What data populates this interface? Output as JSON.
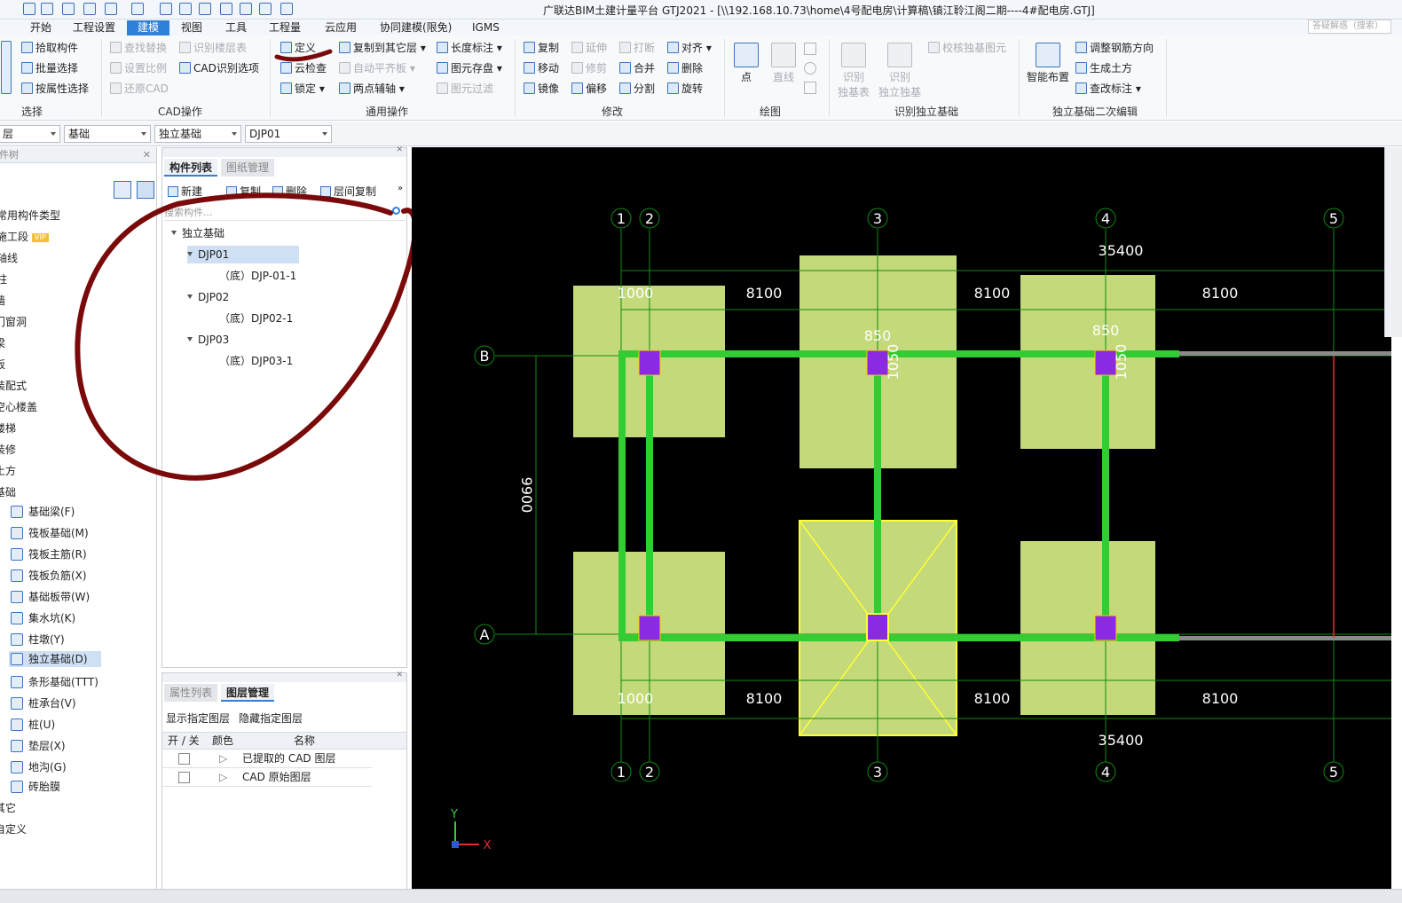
{
  "titlebar": {
    "title": "广联达BIM土建计量平台 GTJ2021 - [\\\\192.168.10.73\\home\\4号配电房\\计算稿\\镇江聆江阁二期----4#配电房.GTJ]",
    "search_placeholder": "答疑解惑（搜索）"
  },
  "menubar": [
    "开始",
    "工程设置",
    "建模",
    "视图",
    "工具",
    "工程量",
    "云应用",
    "协同建模(限免)",
    "IGMS"
  ],
  "ribbon": {
    "select": {
      "pick": "拾取构件",
      "batch": "批量选择",
      "by_attr": "按属性选择",
      "group": "选择"
    },
    "cad": {
      "find_replace": "查找替换",
      "identify_table": "识别楼层表",
      "set_scale": "设置比例",
      "cad_options": "CAD识别选项",
      "restore_cad": "还原CAD",
      "group": "CAD操作"
    },
    "common": {
      "define": "定义",
      "cloud_check": "云检查",
      "lock": "锁定",
      "copy_to_floor": "复制到其它层",
      "auto_align": "自动平齐板",
      "two_point_axis": "两点辅轴",
      "length_mark": "长度标注",
      "element_save": "图元存盘",
      "element_filter": "图元过滤",
      "group": "通用操作"
    },
    "modify": {
      "copy": "复制",
      "extend": "延伸",
      "break": "打断",
      "align": "对齐",
      "move": "移动",
      "trim": "修剪",
      "merge": "合并",
      "delete": "删除",
      "mirror": "镜像",
      "offset": "偏移",
      "split": "分割",
      "rotate": "旋转",
      "group": "修改"
    },
    "draw": {
      "point": "点",
      "line": "直线",
      "group": "绘图"
    },
    "identify": {
      "check": "校核独基图元",
      "table_l1": "识别",
      "table_l2": "独基表",
      "found_l1": "识别",
      "found_l2": "独立独基",
      "group": "识别独立基础"
    },
    "edit2": {
      "smart": "智能布置",
      "adjust_rebar": "调整钢筋方向",
      "gen_earth": "生成土方",
      "check_mark": "查改标注",
      "group": "独立基础二次编辑"
    }
  },
  "filters": [
    "层",
    "基础",
    "独立基础",
    "DJP01"
  ],
  "left_panel": {
    "header": "构件树",
    "items": [
      "常用构件类型",
      "施工段",
      "轴线",
      "柱",
      "墙",
      "门窗洞",
      "梁",
      "板",
      "装配式",
      "空心楼盖",
      "楼梯",
      "装修",
      "土方",
      "基础"
    ],
    "vip": "VIP",
    "foundation_items": [
      "基础梁(F)",
      "筏板基础(M)",
      "筏板主筋(R)",
      "筏板负筋(X)",
      "基础板带(W)",
      "集水坑(K)",
      "柱墩(Y)",
      "独立基础(D)",
      "条形基础(TTT)",
      "桩承台(V)",
      "桩(U)",
      "垫层(X)",
      "地沟(G)",
      "砖胎膜"
    ],
    "tail_items": [
      "其它",
      "自定义"
    ]
  },
  "mid_panel": {
    "tabs": [
      "构件列表",
      "图纸管理"
    ],
    "toolbar": {
      "new": "新建",
      "copy": "复制",
      "delete": "删除",
      "floor_copy": "层间复制"
    },
    "search_placeholder": "搜索构件...",
    "tree_root": "独立基础",
    "nodes": [
      {
        "name": "DJP01",
        "child": "（底）DJP-01-1"
      },
      {
        "name": "DJP02",
        "child": "（底）DJP02-1"
      },
      {
        "name": "DJP03",
        "child": "（底）DJP03-1"
      }
    ]
  },
  "bottom_panel": {
    "tabs": [
      "属性列表",
      "图层管理"
    ],
    "actions": [
      "显示指定图层",
      "隐藏指定图层"
    ],
    "columns": [
      "开 / 关",
      "颜色",
      "名称"
    ],
    "rows": [
      "已提取的 CAD 图层",
      "CAD 原始图层"
    ]
  },
  "canvas": {
    "axis_labels": [
      "1",
      "2",
      "3",
      "4",
      "5"
    ],
    "row_labels": [
      "B",
      "A"
    ],
    "dims": {
      "total": "35400",
      "d1": "1000",
      "d2": "8100",
      "h": "9900",
      "b": "850",
      "v": "1050"
    },
    "coord_labels": {
      "y": "Y",
      "x": "X"
    },
    "colors": {
      "pad": "#c4d97a",
      "beam": "#33cc33",
      "column": "#8a2be2",
      "grid": "#0f8a0f",
      "highlight": "#ffff33",
      "annotation": "#7a0a0a"
    }
  }
}
